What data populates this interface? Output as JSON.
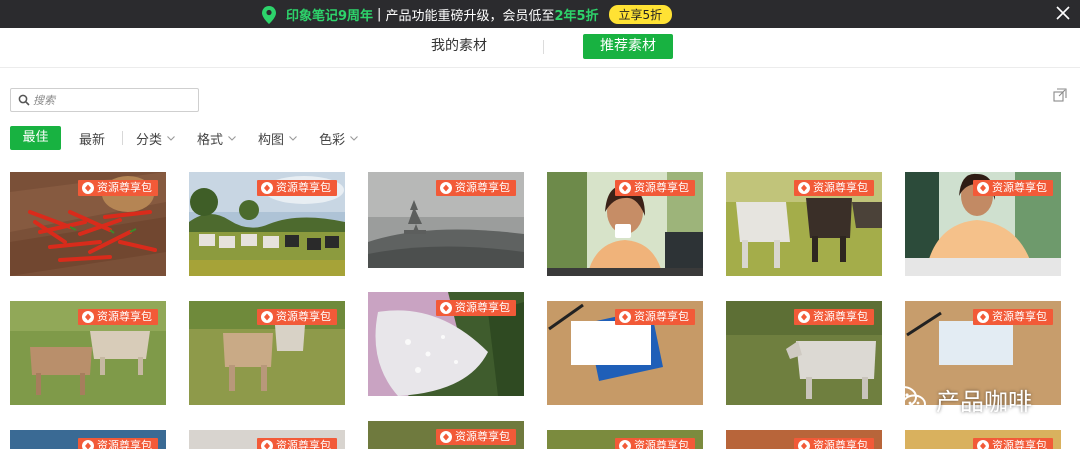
{
  "promo": {
    "brand": "印象笔记9周年",
    "separator": "|",
    "text_before": "产品功能重磅升级，会员低至",
    "highlight": "2年5折",
    "badge": "立享5折"
  },
  "tabs": [
    {
      "label": "我的素材"
    },
    {
      "label": "推荐素材"
    }
  ],
  "search": {
    "placeholder": "搜索"
  },
  "filters": {
    "best": "最佳",
    "newest": "最新",
    "category": "分类",
    "format": "格式",
    "composition": "构图",
    "color": "色彩"
  },
  "tiles": [
    {
      "tag": "资源尊享包"
    },
    {
      "tag": "资源尊享包"
    },
    {
      "tag": "资源尊享包"
    },
    {
      "tag": "资源尊享包"
    },
    {
      "tag": "资源尊享包"
    },
    {
      "tag": "资源尊享包"
    },
    {
      "tag": "资源尊享包"
    },
    {
      "tag": "资源尊享包"
    },
    {
      "tag": "资源尊享包"
    },
    {
      "tag": "资源尊享包"
    },
    {
      "tag": "资源尊享包"
    },
    {
      "tag": "资源尊享包"
    },
    {
      "tag": "资源尊享包"
    },
    {
      "tag": "资源尊享包"
    },
    {
      "tag": "资源尊享包"
    },
    {
      "tag": "资源尊享包"
    },
    {
      "tag": "资源尊享包"
    },
    {
      "tag": "资源尊享包"
    }
  ],
  "watermark": {
    "text": "产品咖啡"
  },
  "colors": {
    "accent": "#18b241",
    "tag": "#f25a38",
    "promo_bg": "#2b2b2e",
    "badge": "#ffe234"
  }
}
